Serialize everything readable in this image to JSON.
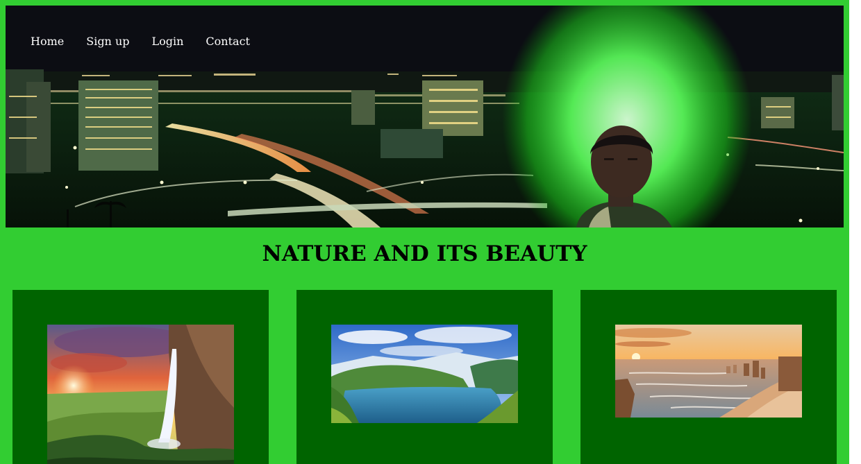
{
  "nav": {
    "items": [
      {
        "label": "Home"
      },
      {
        "label": "Sign up"
      },
      {
        "label": "Login"
      },
      {
        "label": "Contact"
      }
    ]
  },
  "main": {
    "title": "NATURE AND ITS BEAUTY",
    "cards": [
      {
        "image": "waterfall-sunset-photo"
      },
      {
        "image": "fjord-mountains-photo"
      },
      {
        "image": "coastal-rocks-sunset-photo"
      }
    ]
  },
  "colors": {
    "page_background": "#32cd32",
    "card_background": "#006400",
    "nav_text": "#ffffff",
    "title_text": "#000000"
  }
}
